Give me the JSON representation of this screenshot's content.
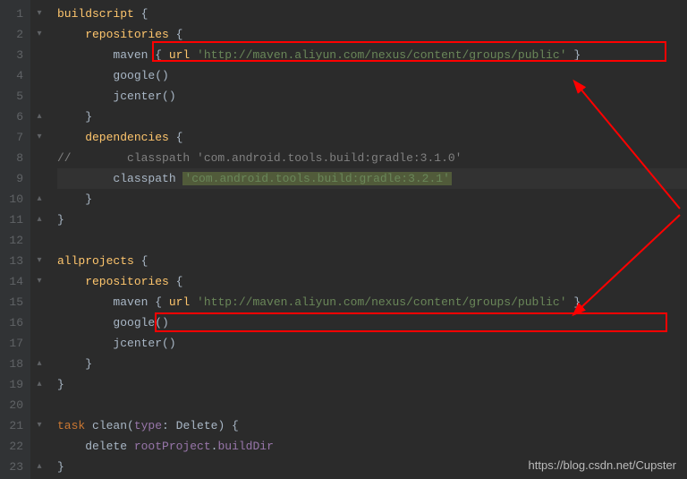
{
  "lineNumbers": [
    "1",
    "2",
    "3",
    "4",
    "5",
    "6",
    "7",
    "8",
    "9",
    "10",
    "11",
    "12",
    "13",
    "14",
    "15",
    "16",
    "17",
    "18",
    "19",
    "20",
    "21",
    "22",
    "23"
  ],
  "foldMarks": [
    "▾",
    "▾",
    "",
    "",
    "",
    "▴",
    "▾",
    "",
    "",
    "▴",
    "▴",
    "",
    "▾",
    "▾",
    "",
    "",
    "",
    "▴",
    "▴",
    "",
    "▾",
    "",
    "▴"
  ],
  "code": {
    "l1": {
      "a": "buildscript",
      "b": " {"
    },
    "l2": {
      "a": "    repositories",
      "b": " {"
    },
    "l3": {
      "a": "        maven { ",
      "b": "url",
      "c": " ",
      "d": "'http://maven.aliyun.com/nexus/content/groups/public'",
      "e": " }"
    },
    "l4": {
      "a": "        google()"
    },
    "l5": {
      "a": "        jcenter()"
    },
    "l6": {
      "a": "    }"
    },
    "l7": {
      "a": "    dependencies",
      "b": " {"
    },
    "l8": {
      "a": "//        classpath 'com.android.tools.build:gradle:3.1.0'"
    },
    "l9": {
      "a": "        classpath ",
      "b": "'com.android.tools.build:gradle:3.2.1'"
    },
    "l10": {
      "a": "    }"
    },
    "l11": {
      "a": "}"
    },
    "l12": {
      "a": ""
    },
    "l13": {
      "a": "allprojects",
      "b": " {"
    },
    "l14": {
      "a": "    repositories",
      "b": " {"
    },
    "l15": {
      "a": "        maven { ",
      "b": "url",
      "c": " ",
      "d": "'http://maven.aliyun.com/nexus/content/groups/public'",
      "e": " }"
    },
    "l16": {
      "a": "        google()"
    },
    "l17": {
      "a": "        jcenter()"
    },
    "l18": {
      "a": "    }"
    },
    "l19": {
      "a": "}"
    },
    "l20": {
      "a": ""
    },
    "l21": {
      "a": "task",
      "b": " clean(",
      "c": "type",
      "d": ": Delete) {"
    },
    "l22": {
      "a": "    delete ",
      "b": "rootProject",
      "c": ".",
      "d": "buildDir"
    },
    "l23": {
      "a": "}"
    }
  },
  "watermark": "https://blog.csdn.net/Cupster"
}
